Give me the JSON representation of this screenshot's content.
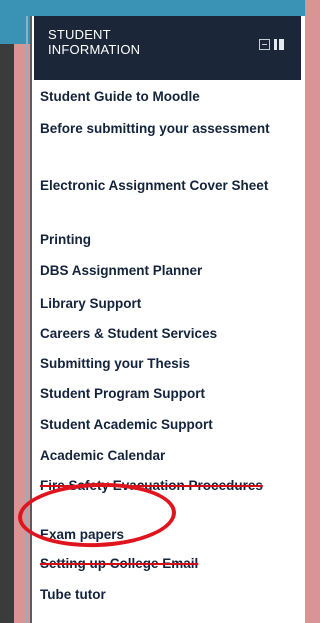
{
  "block": {
    "title_line1": "STUDENT",
    "title_line2": "INFORMATION",
    "minimize_icon": "minus-box-icon",
    "dock_icon": "dock-icon",
    "items": [
      {
        "label": "Student Guide to Moodle"
      },
      {
        "label": "Before submitting your assessment"
      },
      {
        "label": "Electronic Assignment Cover Sheet"
      },
      {
        "label": "Printing"
      },
      {
        "label": "DBS Assignment Planner"
      },
      {
        "label": "Library Support"
      },
      {
        "label": "Careers & Student Services"
      },
      {
        "label": "Submitting your Thesis"
      },
      {
        "label": "Student Program Support"
      },
      {
        "label": "Student Academic Support"
      },
      {
        "label": "Academic Calendar"
      },
      {
        "label": "Fire Safety Evacuation Procedures"
      },
      {
        "label": "Exam papers"
      },
      {
        "label": "Setting up College Email"
      },
      {
        "label": "Tube tutor"
      }
    ]
  },
  "colors": {
    "header_bg": "#1b2639",
    "link_text": "#14233c",
    "highlight": "#e0141d",
    "page_bg": "#d99493",
    "top_bar": "#3a93b4"
  }
}
